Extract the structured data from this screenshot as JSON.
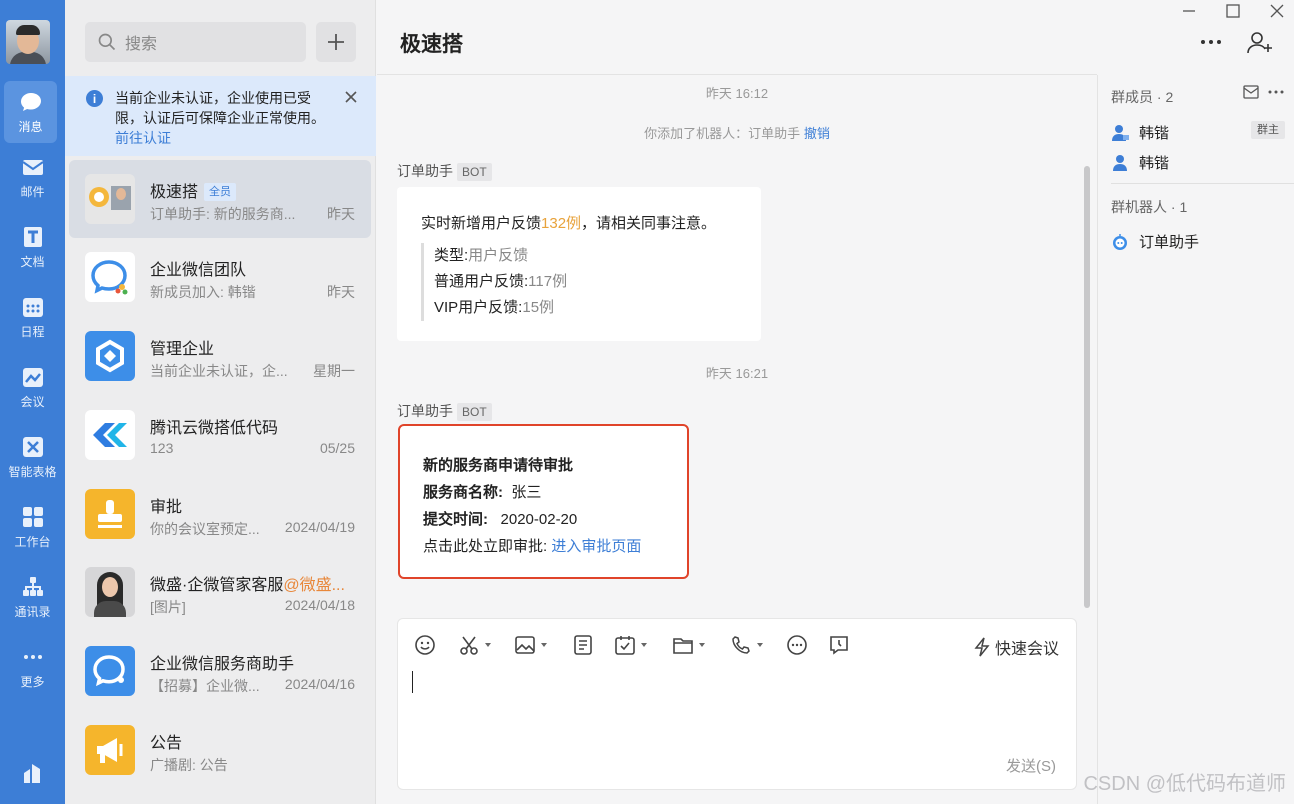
{
  "nav": {
    "items": [
      {
        "label": "消息",
        "icon": "message-icon"
      },
      {
        "label": "邮件",
        "icon": "mail-icon"
      },
      {
        "label": "文档",
        "icon": "doc-icon"
      },
      {
        "label": "日程",
        "icon": "calendar-icon"
      },
      {
        "label": "会议",
        "icon": "meeting-icon"
      },
      {
        "label": "智能表格",
        "icon": "smart-table-icon"
      },
      {
        "label": "工作台",
        "icon": "workbench-icon"
      },
      {
        "label": "通讯录",
        "icon": "contacts-icon"
      },
      {
        "label": "更多",
        "icon": "more-icon"
      }
    ]
  },
  "list": {
    "search_placeholder": "搜索",
    "notice": {
      "text": "当前企业未认证，企业使用已受限，认证后可保障企业正常使用。",
      "link": "前往认证"
    },
    "conversations": [
      {
        "name": "极速搭",
        "tag": "全员",
        "preview": "订单助手: 新的服务商...",
        "time": "昨天"
      },
      {
        "name": "企业微信团队",
        "preview": "新成员加入: 韩锴",
        "time": "昨天"
      },
      {
        "name": "管理企业",
        "preview": "当前企业未认证，企...",
        "time": "星期一"
      },
      {
        "name": "腾讯云微搭低代码",
        "preview": "123",
        "time": "05/25"
      },
      {
        "name": "审批",
        "preview": "你的会议室预定...",
        "time": "2024/04/19"
      },
      {
        "name": "微盛·企微管家客服",
        "at": "@微盛...",
        "preview": "[图片]",
        "time": "2024/04/18"
      },
      {
        "name": "企业微信服务商助手",
        "preview": "【招募】企业微...",
        "time": "2024/04/16"
      },
      {
        "name": "公告",
        "preview": "广播剧: 公告",
        "time": ""
      }
    ]
  },
  "chat": {
    "title": "极速搭",
    "sys1": "昨天 16:12",
    "sys2_prefix": "你添加了机器人：订单助手",
    "sys2_link": "撤销",
    "sys3": "昨天 16:21",
    "sender": "订单助手",
    "bot_tag": "BOT",
    "msg1": {
      "line_prefix": "实时新增用户反馈",
      "highlight": "132例",
      "line_suffix": "，请相关同事注意。",
      "q1_label": "类型:",
      "q1_value": "用户反馈",
      "q2_label": "普通用户反馈:",
      "q2_value": "117例",
      "q3_label": "VIP用户反馈:",
      "q3_value": "15例"
    },
    "msg2": {
      "title": "新的服务商申请待审批",
      "name_label": "服务商名称:",
      "name_value": "张三",
      "time_label": "提交时间:",
      "time_value": "2020-02-20",
      "action_prefix": "点击此处立即审批:",
      "action_link": "进入审批页面"
    },
    "quick_meeting": "快速会议",
    "send": "发送(S)"
  },
  "right": {
    "members_title": "群成员 · 2",
    "members": [
      {
        "name": "韩锴",
        "tag": "群主"
      },
      {
        "name": "韩锴"
      }
    ],
    "bots_title": "群机器人 · 1",
    "bots": [
      {
        "name": "订单助手"
      }
    ]
  },
  "watermark": "CSDN @低代码布道师",
  "colors": {
    "accent": "#3d7ed6",
    "highlight_border": "#e0442a",
    "number": "#e8a33c"
  }
}
